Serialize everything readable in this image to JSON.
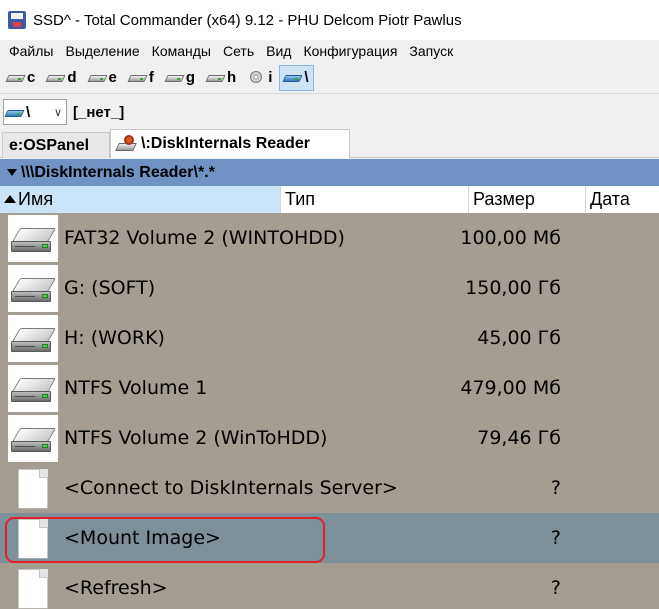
{
  "window": {
    "title": "SSD^ - Total Commander (x64) 9.12 - PHU Delcom Piotr Pawlus"
  },
  "menu": [
    "Файлы",
    "Выделение",
    "Команды",
    "Сеть",
    "Вид",
    "Конфигурация",
    "Запуск"
  ],
  "drives": [
    {
      "letter": "c",
      "icon": "hdd-icon"
    },
    {
      "letter": "d",
      "icon": "hdd-icon"
    },
    {
      "letter": "e",
      "icon": "hdd-icon"
    },
    {
      "letter": "f",
      "icon": "hdd-icon"
    },
    {
      "letter": "g",
      "icon": "hdd-icon"
    },
    {
      "letter": "h",
      "icon": "hdd-icon"
    },
    {
      "letter": "i",
      "icon": "cdrom-icon"
    },
    {
      "letter": "\\",
      "icon": "network-icon",
      "active": true
    }
  ],
  "pathbar": {
    "drive": "\\",
    "volume_label": "[_нет_]"
  },
  "tabs": [
    {
      "label": "e:OSPanel",
      "active": false
    },
    {
      "label": "\\:DiskInternals Reader",
      "active": true
    }
  ],
  "current_path": "\\\\\\DiskInternals Reader\\*.*",
  "columns": {
    "name": "Имя",
    "type": "Тип",
    "size": "Размер",
    "date": "Дата"
  },
  "files": [
    {
      "name": "FAT32 Volume 2 (WINTOHDD)",
      "size": "100,00 Мб",
      "icon": "hdd-icon"
    },
    {
      "name": "G: (SOFT)",
      "size": "150,00 Гб",
      "icon": "hdd-icon"
    },
    {
      "name": "H: (WORK)",
      "size": "45,00 Гб",
      "icon": "hdd-icon"
    },
    {
      "name": "NTFS Volume 1",
      "size": "479,00 Мб",
      "icon": "hdd-icon"
    },
    {
      "name": "NTFS Volume 2 (WinToHDD)",
      "size": "79,46 Гб",
      "icon": "hdd-icon"
    },
    {
      "name": "<Connect to DiskInternals Server>",
      "size": "?",
      "icon": "file-icon"
    },
    {
      "name": "<Mount Image>",
      "size": "?",
      "icon": "file-icon",
      "selected": true
    },
    {
      "name": "<Refresh>",
      "size": "?",
      "icon": "file-icon"
    }
  ],
  "colors": {
    "header_bar": "#6f93c4",
    "list_bg": "#a59d91",
    "selected_row": "#7d8f98",
    "highlight_ring": "#e0202a"
  }
}
